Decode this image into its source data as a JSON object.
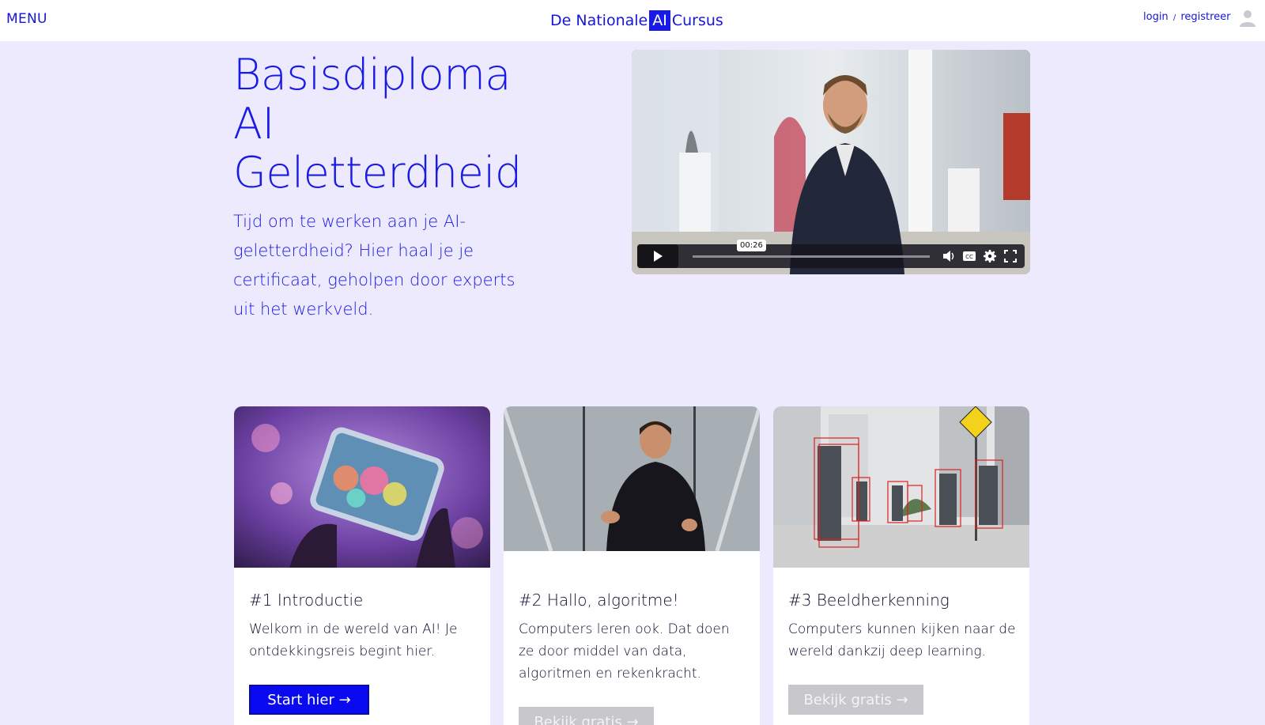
{
  "nav": {
    "menu_label": "MENU",
    "brand_pre": "De Nationale",
    "brand_ai": "AI",
    "brand_post": "Cursus",
    "login_label": "login",
    "separator": "/",
    "register_label": "registreer"
  },
  "hero": {
    "title_line1": "Basisdiploma",
    "title_line2": "AI",
    "title_line3": "Geletterdheid",
    "text": "Tijd om te werken aan je AI-geletterdheid? Hier haal je je certificaat, geholpen door experts uit het werkveld."
  },
  "video": {
    "timestamp": "00:26",
    "progress_fraction": 0.0
  },
  "cards": [
    {
      "title": "#1 Introductie",
      "text": "Welkom in de wereld van AI! Je ontdekkingsreis begint hier.",
      "button": "Start hier →"
    },
    {
      "title": "#2 Hallo, algoritme!",
      "text": "Computers leren ook. Dat doen ze door middel van data, algoritmen en rekenkracht.",
      "button": "Bekijk gratis →"
    },
    {
      "title": "#3 Beeldherkenning",
      "text": "Computers kunnen kijken naar de wereld dankzij deep learning.",
      "button": "Bekijk gratis →"
    }
  ],
  "colors": {
    "accent": "#1a1ae6",
    "page_bg": "#eceafc",
    "disabled_button": "#c8c8cc"
  }
}
